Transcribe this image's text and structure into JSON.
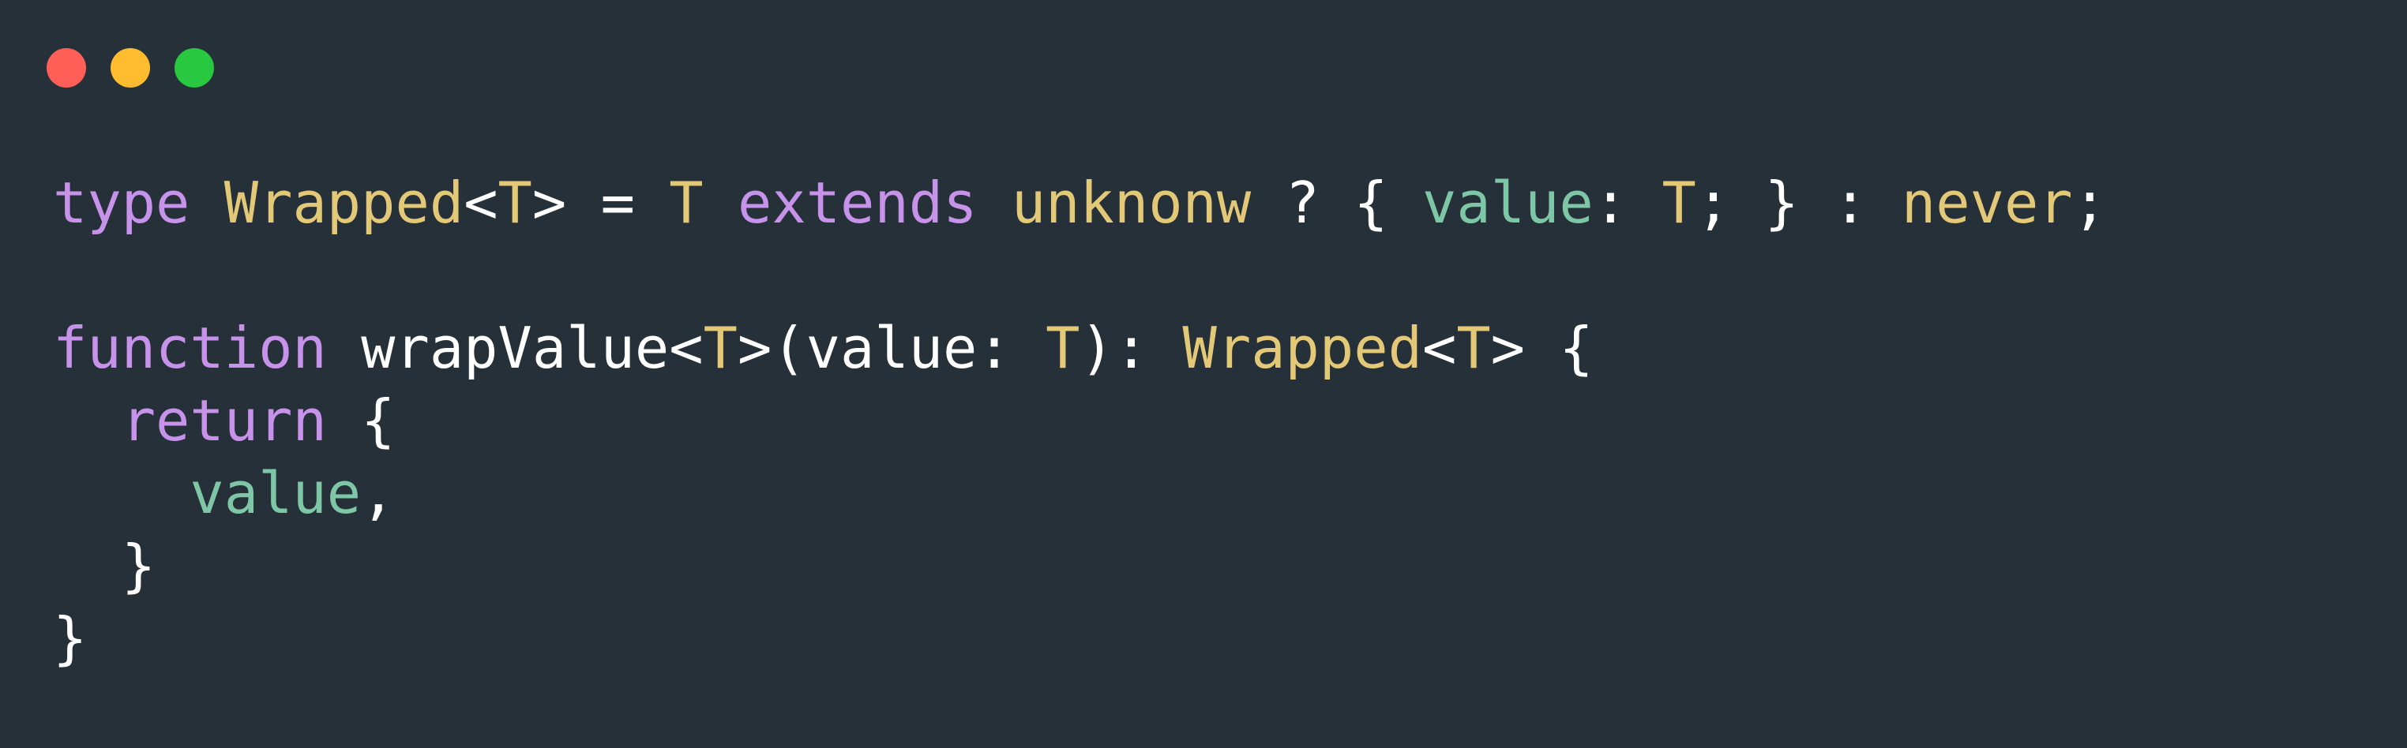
{
  "window": {
    "background": "#263039",
    "traffic_lights": [
      {
        "name": "close",
        "color": "#ff5f57"
      },
      {
        "name": "minimize",
        "color": "#febc2e"
      },
      {
        "name": "zoom",
        "color": "#28c840"
      }
    ]
  },
  "theme": {
    "keyword": "#c792ea",
    "type": "#e3c878",
    "property": "#7ec7a6",
    "plain": "#ffffff"
  },
  "code": {
    "lines": [
      [
        {
          "text": "type",
          "kind": "keyword"
        },
        {
          "text": " ",
          "kind": "plain"
        },
        {
          "text": "Wrapped",
          "kind": "type"
        },
        {
          "text": "<",
          "kind": "plain"
        },
        {
          "text": "T",
          "kind": "type"
        },
        {
          "text": "> = ",
          "kind": "plain"
        },
        {
          "text": "T",
          "kind": "type"
        },
        {
          "text": " ",
          "kind": "plain"
        },
        {
          "text": "extends",
          "kind": "keyword"
        },
        {
          "text": " ",
          "kind": "plain"
        },
        {
          "text": "unknonw",
          "kind": "type"
        },
        {
          "text": " ? { ",
          "kind": "plain"
        },
        {
          "text": "value",
          "kind": "property"
        },
        {
          "text": ": ",
          "kind": "plain"
        },
        {
          "text": "T",
          "kind": "type"
        },
        {
          "text": "; } : ",
          "kind": "plain"
        },
        {
          "text": "never",
          "kind": "type"
        },
        {
          "text": ";",
          "kind": "plain"
        }
      ],
      [],
      [
        {
          "text": "function",
          "kind": "keyword"
        },
        {
          "text": " wrapValue<",
          "kind": "plain"
        },
        {
          "text": "T",
          "kind": "type"
        },
        {
          "text": ">(value: ",
          "kind": "plain"
        },
        {
          "text": "T",
          "kind": "type"
        },
        {
          "text": "): ",
          "kind": "plain"
        },
        {
          "text": "Wrapped",
          "kind": "type"
        },
        {
          "text": "<",
          "kind": "plain"
        },
        {
          "text": "T",
          "kind": "type"
        },
        {
          "text": "> {",
          "kind": "plain"
        }
      ],
      [
        {
          "text": "  ",
          "kind": "plain"
        },
        {
          "text": "return",
          "kind": "keyword"
        },
        {
          "text": " {",
          "kind": "plain"
        }
      ],
      [
        {
          "text": "    ",
          "kind": "plain"
        },
        {
          "text": "value",
          "kind": "property"
        },
        {
          "text": ",",
          "kind": "plain"
        }
      ],
      [
        {
          "text": "  }",
          "kind": "plain"
        }
      ],
      [
        {
          "text": "}",
          "kind": "plain"
        }
      ]
    ]
  }
}
